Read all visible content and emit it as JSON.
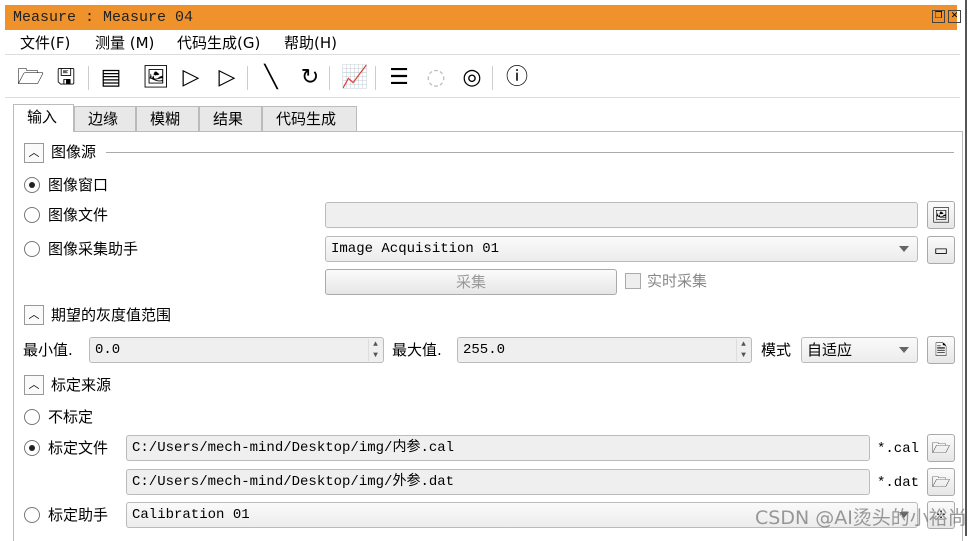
{
  "window": {
    "title": "Measure : Measure 04"
  },
  "menu": [
    {
      "label": "文件(F)"
    },
    {
      "label": "测量 (M)"
    },
    {
      "label": "代码生成(G)"
    },
    {
      "label": "帮助(H)"
    }
  ],
  "toolbar": [
    "open-folder-icon",
    "save-icon",
    "parameters-icon",
    "open-image-icon",
    "play-acquisition-icon",
    "camera-play-icon",
    "line-icon",
    "arc-icon",
    "chart-icon",
    "list-icon",
    "circle-delete-disabled-icon",
    "circle-delete-icon",
    "help-icon"
  ],
  "tabs": [
    {
      "label": "输入"
    },
    {
      "label": "边缘"
    },
    {
      "label": "模糊"
    },
    {
      "label": "结果"
    },
    {
      "label": "代码生成"
    }
  ],
  "image_source": {
    "header": "图像源",
    "options": [
      {
        "label": "图像窗口",
        "selected": true
      },
      {
        "label": "图像文件",
        "selected": false
      },
      {
        "label": "图像采集助手",
        "selected": false
      }
    ],
    "file_value": "",
    "acq_value": "Image Acquisition 01",
    "acquire_label": "采集",
    "live_label": "实时采集",
    "live_checked": false
  },
  "gray_range": {
    "header": "期望的灰度值范围",
    "min_label": "最小值.",
    "min_value": "0.0",
    "max_label": "最大值.",
    "max_value": "255.0",
    "mode_label": "模式",
    "mode_value": "自适应"
  },
  "calibration": {
    "header": "标定来源",
    "none_label": "不标定",
    "file_label": "标定文件",
    "internal_path": "C:/Users/mech-mind/Desktop/img/内参.cal",
    "internal_ext": "*.cal",
    "external_path": "C:/Users/mech-mind/Desktop/img/外参.dat",
    "external_ext": "*.dat",
    "assistant_label": "标定助手",
    "assistant_value": "Calibration 01",
    "selected": "file"
  },
  "watermark": "CSDN @AI烫头的小裕尚",
  "colors": {
    "titlebar": "#f0922b"
  }
}
